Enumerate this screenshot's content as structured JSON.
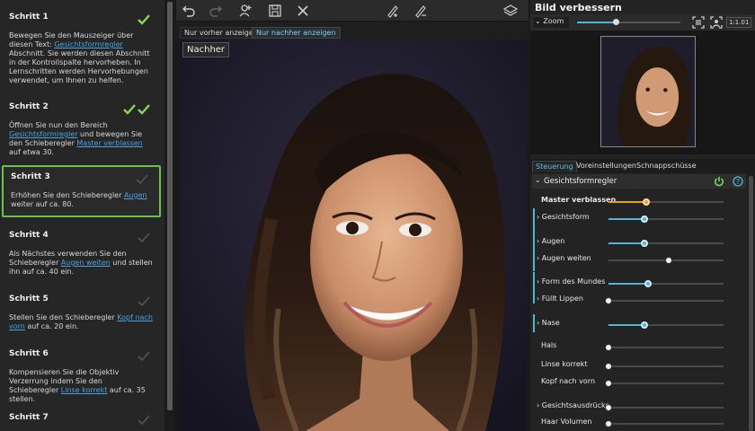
{
  "steps": [
    {
      "title": "Schritt 1",
      "text_before": "Bewegen Sie den Mauszeiger über diesen Text: ",
      "link": "Gesichtsformregler",
      "text_after": " Abschnitt. Sie werden diesen Abschnitt in der Kontrollspalte hervorheben. In Lernschritten werden Hervorhebungen verwendet, um Ihnen zu helfen.",
      "status": "done-1"
    },
    {
      "title": "Schritt 2",
      "text_before": "Öffnen Sie nun den Bereich ",
      "link": "Gesichtsformregler",
      "text_middle": " und bewegen Sie den Schieberegler ",
      "link2": "Master verblassen",
      "text_after": " auf etwa 30.",
      "status": "done-2"
    },
    {
      "title": "Schritt 3",
      "text_before": "Erhöhen Sie den Schieberegler ",
      "link": "Augen",
      "text_after": " weiter auf ca. 80.",
      "status": "active"
    },
    {
      "title": "Schritt 4",
      "text_before": "Als Nächstes verwenden Sie den Schieberegler ",
      "link": "Augen weiten",
      "text_after": " und stellen ihn auf ca. 40 ein.",
      "status": "todo"
    },
    {
      "title": "Schritt 5",
      "text_before": "Stellen Sie den Schieberegler ",
      "link": "Kopf nach vorn",
      "text_after": " auf ca. 20 ein.",
      "status": "todo"
    },
    {
      "title": "Schritt 6",
      "text_before": "Kompensieren Sie die Objektiv Verzerrung indem Sie den Schieberegler ",
      "link": "Linse korrekt",
      "text_after": " auf ca. 35 stellen.",
      "status": "todo"
    },
    {
      "title": "Schritt 7",
      "status": "todo"
    }
  ],
  "toolbar": {
    "icons": [
      "undo-icon",
      "redo-icon",
      "add-person-icon",
      "save-icon",
      "close-icon",
      "pen-add-icon",
      "pen-remove-icon",
      "layers-icon"
    ]
  },
  "view_tabs": {
    "before": "Nur vorher anzeigen",
    "after": "Nur nachher anzeigen"
  },
  "photo": {
    "badge": "Nachher"
  },
  "right_panel": {
    "title": "Bild verbessern",
    "zoom": {
      "label": "Zoom",
      "value": 0.37,
      "ratio": "1:1.01"
    },
    "tabs": [
      "Steuerung",
      "Voreinstellungen",
      "Schnappschüsse"
    ],
    "section": "Gesichtsformregler",
    "controls": [
      {
        "label": "Master verblassen",
        "value": 0.33,
        "style": "gold",
        "bold": true,
        "expand": false
      },
      {
        "label": "Gesichtsform",
        "value": 0.31,
        "style": "blue",
        "expand": true
      },
      {
        "label": "Augen",
        "value": 0.31,
        "style": "blue",
        "expand": true
      },
      {
        "label": "Augen weiten",
        "value": 0.52,
        "style": "white",
        "expand": true
      },
      {
        "label": "Form des Mundes",
        "value": 0.34,
        "style": "blue",
        "expand": true
      },
      {
        "label": "Füllt Lippen",
        "value": 0.0,
        "style": "white",
        "expand": true
      },
      {
        "label": "Nase",
        "value": 0.31,
        "style": "blue",
        "expand": true
      },
      {
        "label": "Hals",
        "value": 0.0,
        "style": "white",
        "expand": false
      },
      {
        "label": "Linse korrekt",
        "value": 0.0,
        "style": "white",
        "expand": false
      },
      {
        "label": "Kopf nach vorn",
        "value": 0.0,
        "style": "white",
        "expand": false
      },
      {
        "label": "Gesichtsausdrücke",
        "value": 0.0,
        "style": "white",
        "expand": true
      },
      {
        "label": "Haar Volumen",
        "value": 0.0,
        "style": "white",
        "expand": false
      }
    ]
  },
  "colors": {
    "accent": "#4fb4d8",
    "check": "#8cd45a",
    "active_border": "#6cc24a",
    "master": "#e8a020"
  }
}
